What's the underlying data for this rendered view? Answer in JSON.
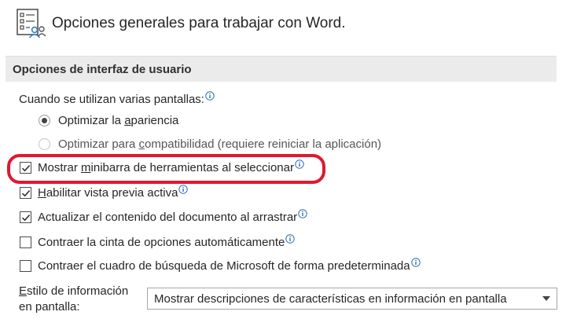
{
  "header": {
    "title": "Opciones generales para trabajar con Word.",
    "icon": "options-list-icon"
  },
  "section": {
    "title": "Opciones de interfaz de usuario"
  },
  "multi_screen": {
    "label": "Cuando se utilizan varias pantallas:",
    "option_appearance": {
      "pre": "Optimizar la ",
      "underlined": "a",
      "post": "pariencia",
      "selected": true
    },
    "option_compat": {
      "pre": "Optimizar para ",
      "underlined": "c",
      "post": "ompatibilidad (requiere reiniciar la aplicación)",
      "selected": false
    }
  },
  "checkboxes": {
    "mini_toolbar": {
      "pre": "Mostrar ",
      "underlined": "m",
      "post": "inibarra de herramientas al seleccionar",
      "checked": true
    },
    "live_preview": {
      "pre": "",
      "underlined": "H",
      "post": "abilitar vista previa activa",
      "checked": true
    },
    "update_drag": {
      "label": "Actualizar el contenido del documento al arrastrar",
      "checked": true
    },
    "collapse_ribbon": {
      "label": "Contraer la cinta de opciones automáticamente",
      "checked": false
    },
    "collapse_search": {
      "label": "Contraer el cuadro de búsqueda de Microsoft de forma predeterminada",
      "checked": false
    }
  },
  "screentip": {
    "label_line1_pre": "",
    "label_line1_underlined": "E",
    "label_line1_post": "stilo de información",
    "label_line2": "en pantalla:",
    "selected_value": "Mostrar descripciones de características en información en pantalla"
  },
  "colors": {
    "highlight": "#e0182f",
    "section_bg": "#ebebeb",
    "info_icon": "#2b6cb0"
  }
}
